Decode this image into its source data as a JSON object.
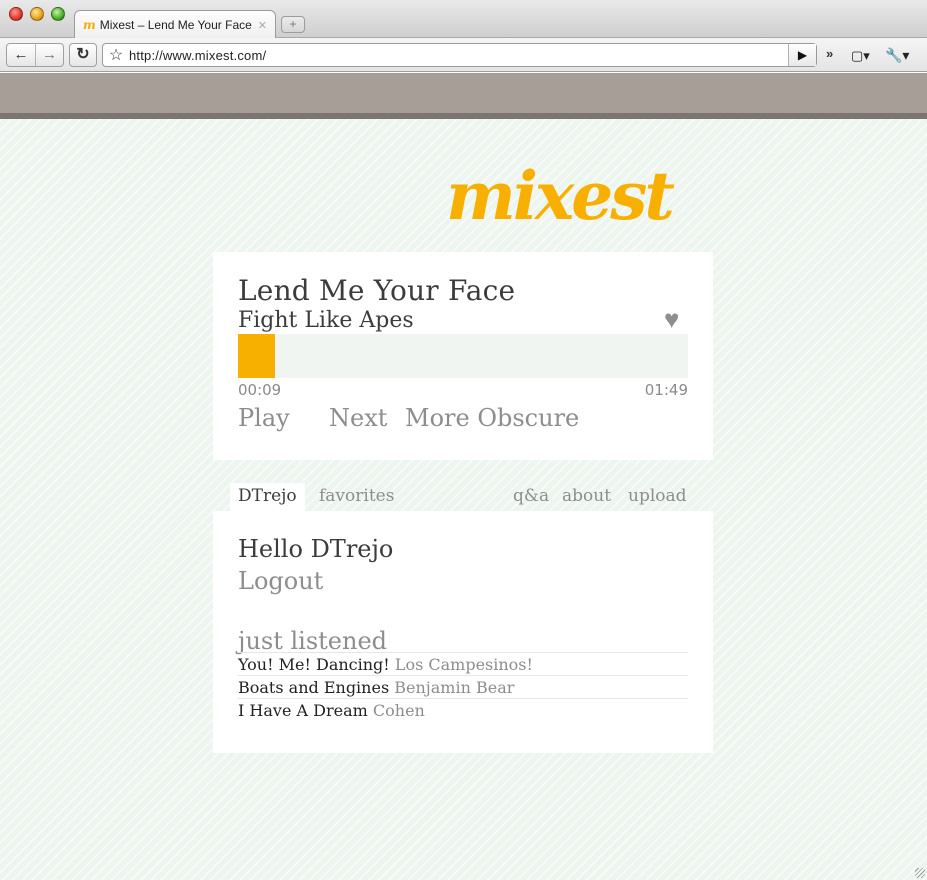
{
  "browser": {
    "tab_title": "Mixest – Lend Me Your Face",
    "tab_favicon": "m",
    "url": "http://www.mixest.com/",
    "icons": {
      "back": "back-arrow-icon",
      "forward": "forward-arrow-icon",
      "reload": "reload-icon",
      "bookmark": "star-icon",
      "go": "play-arrow-icon",
      "overflow": "chevron-right-double-icon",
      "page_menu": "page-icon",
      "tools_menu": "wrench-icon"
    }
  },
  "site": {
    "logo": "mixest",
    "brand_color": "#f8b000"
  },
  "player": {
    "title": "Lend Me Your Face",
    "artist": "Fight Like Apes",
    "current_time": "00:09",
    "total_time": "01:49",
    "progress": 0.083,
    "controls": {
      "play": "Play",
      "next": "Next",
      "more_obscure": "More Obscure"
    }
  },
  "nav": {
    "user_tab": "DTrejo",
    "favorites_tab": "favorites",
    "qa": "q&a",
    "about": "about",
    "upload": "upload"
  },
  "user": {
    "greeting": "Hello DTrejo",
    "logout": "Logout"
  },
  "just_listened": {
    "title": "just listened",
    "items": [
      {
        "title": "You! Me! Dancing!",
        "artist": "Los Campesinos!"
      },
      {
        "title": "Boats and Engines",
        "artist": "Benjamin Bear"
      },
      {
        "title": "I Have A Dream",
        "artist": "Cohen"
      }
    ]
  }
}
